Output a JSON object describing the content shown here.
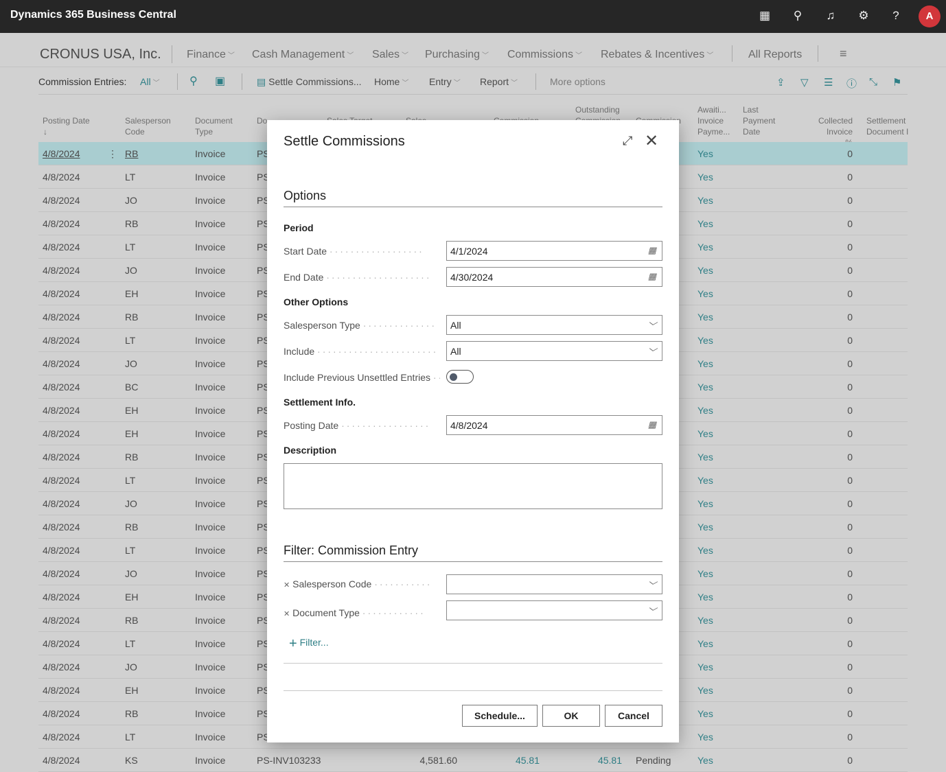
{
  "topbar": {
    "title": "Dynamics 365 Business Central",
    "avatar": "A",
    "icons": [
      "building-icon",
      "search-icon",
      "bell-icon",
      "gear-icon",
      "help-icon"
    ]
  },
  "nav": {
    "company": "CRONUS USA, Inc.",
    "items": [
      "Finance",
      "Cash Management",
      "Sales",
      "Purchasing",
      "Commissions",
      "Rebates & Incentives"
    ],
    "all_reports": "All Reports"
  },
  "toolbar": {
    "page": "Commission Entries:",
    "filter": "All",
    "settle": "Settle Commissions...",
    "home": "Home",
    "entry": "Entry",
    "report": "Report",
    "more": "More options"
  },
  "columns": [
    "Posting Date",
    "Salesperson Code",
    "Document Type",
    "Do",
    "Sales Target",
    "Sales Amount",
    "Commission",
    "Outstanding Commission",
    "Commission",
    "Awaiti... Invoice Payme...",
    "Last Payment Date",
    "Collected Invoice %",
    "Settlement Document I"
  ],
  "rows": [
    {
      "date": "4/8/2024",
      "code": "RB",
      "type": "Invoice",
      "doc": "PS",
      "await": "Yes",
      "pct": "0"
    },
    {
      "date": "4/8/2024",
      "code": "LT",
      "type": "Invoice",
      "doc": "PS",
      "await": "Yes",
      "pct": "0"
    },
    {
      "date": "4/8/2024",
      "code": "JO",
      "type": "Invoice",
      "doc": "PS",
      "await": "Yes",
      "pct": "0"
    },
    {
      "date": "4/8/2024",
      "code": "RB",
      "type": "Invoice",
      "doc": "PS",
      "await": "Yes",
      "pct": "0"
    },
    {
      "date": "4/8/2024",
      "code": "LT",
      "type": "Invoice",
      "doc": "PS",
      "await": "Yes",
      "pct": "0"
    },
    {
      "date": "4/8/2024",
      "code": "JO",
      "type": "Invoice",
      "doc": "PS",
      "await": "Yes",
      "pct": "0"
    },
    {
      "date": "4/8/2024",
      "code": "EH",
      "type": "Invoice",
      "doc": "PS",
      "await": "Yes",
      "pct": "0"
    },
    {
      "date": "4/8/2024",
      "code": "RB",
      "type": "Invoice",
      "doc": "PS",
      "await": "Yes",
      "pct": "0"
    },
    {
      "date": "4/8/2024",
      "code": "LT",
      "type": "Invoice",
      "doc": "PS",
      "await": "Yes",
      "pct": "0"
    },
    {
      "date": "4/8/2024",
      "code": "JO",
      "type": "Invoice",
      "doc": "PS",
      "await": "Yes",
      "pct": "0"
    },
    {
      "date": "4/8/2024",
      "code": "BC",
      "type": "Invoice",
      "doc": "PS",
      "await": "Yes",
      "pct": "0"
    },
    {
      "date": "4/8/2024",
      "code": "EH",
      "type": "Invoice",
      "doc": "PS",
      "await": "Yes",
      "pct": "0"
    },
    {
      "date": "4/8/2024",
      "code": "EH",
      "type": "Invoice",
      "doc": "PS",
      "await": "Yes",
      "pct": "0"
    },
    {
      "date": "4/8/2024",
      "code": "RB",
      "type": "Invoice",
      "doc": "PS",
      "await": "Yes",
      "pct": "0"
    },
    {
      "date": "4/8/2024",
      "code": "LT",
      "type": "Invoice",
      "doc": "PS",
      "await": "Yes",
      "pct": "0"
    },
    {
      "date": "4/8/2024",
      "code": "JO",
      "type": "Invoice",
      "doc": "PS",
      "await": "Yes",
      "pct": "0"
    },
    {
      "date": "4/8/2024",
      "code": "RB",
      "type": "Invoice",
      "doc": "PS",
      "await": "Yes",
      "pct": "0"
    },
    {
      "date": "4/8/2024",
      "code": "LT",
      "type": "Invoice",
      "doc": "PS",
      "await": "Yes",
      "pct": "0"
    },
    {
      "date": "4/8/2024",
      "code": "JO",
      "type": "Invoice",
      "doc": "PS",
      "await": "Yes",
      "pct": "0"
    },
    {
      "date": "4/8/2024",
      "code": "EH",
      "type": "Invoice",
      "doc": "PS",
      "await": "Yes",
      "pct": "0"
    },
    {
      "date": "4/8/2024",
      "code": "RB",
      "type": "Invoice",
      "doc": "PS",
      "await": "Yes",
      "pct": "0"
    },
    {
      "date": "4/8/2024",
      "code": "LT",
      "type": "Invoice",
      "doc": "PS",
      "await": "Yes",
      "pct": "0"
    },
    {
      "date": "4/8/2024",
      "code": "JO",
      "type": "Invoice",
      "doc": "PS",
      "await": "Yes",
      "pct": "0"
    },
    {
      "date": "4/8/2024",
      "code": "EH",
      "type": "Invoice",
      "doc": "PS",
      "await": "Yes",
      "pct": "0"
    },
    {
      "date": "4/8/2024",
      "code": "RB",
      "type": "Invoice",
      "doc": "PS",
      "await": "Yes",
      "pct": "0"
    },
    {
      "date": "4/8/2024",
      "code": "LT",
      "type": "Invoice",
      "doc": "PS",
      "await": "Yes",
      "pct": "0"
    },
    {
      "date": "4/8/2024",
      "code": "KS",
      "type": "Invoice",
      "doc": "PS-INV103233",
      "amount": "4,581.60",
      "commission": "45.81",
      "outstanding": "45.81",
      "status": "Pending",
      "await": "Yes",
      "pct": "0"
    }
  ],
  "dialog": {
    "title": "Settle Commissions",
    "options": "Options",
    "period": "Period",
    "start_label": "Start Date",
    "start": "4/1/2024",
    "end_label": "End Date",
    "end": "4/30/2024",
    "other": "Other Options",
    "sp_type_label": "Salesperson Type",
    "sp_type": "All",
    "include_label": "Include",
    "include": "All",
    "prev_label": "Include Previous Unsettled Entries",
    "prev_on": false,
    "settle_info": "Settlement Info.",
    "posting_label": "Posting Date",
    "posting": "4/8/2024",
    "description": "Description",
    "description_value": "",
    "filter_title": "Filter: Commission Entry",
    "f1": "Salesperson Code",
    "f2": "Document Type",
    "add_filter": "Filter...",
    "schedule": "Schedule...",
    "ok": "OK",
    "cancel": "Cancel"
  }
}
